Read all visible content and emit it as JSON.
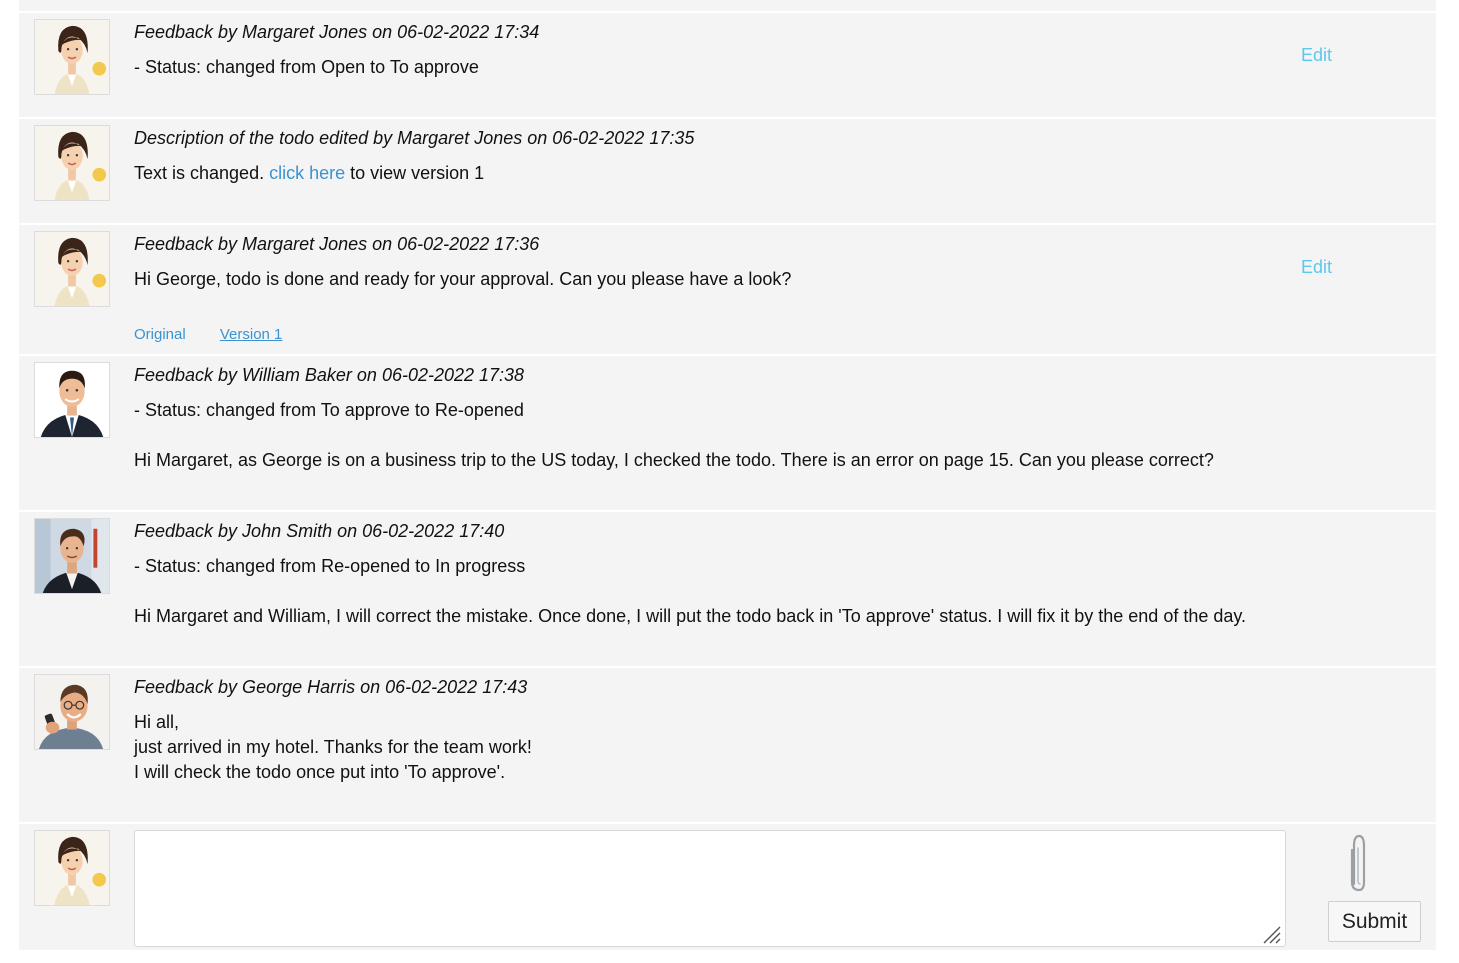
{
  "entries": [
    {
      "author": "margaret",
      "header": "Feedback by Margaret Jones on 06-02-2022 17:34",
      "lines": [
        "- Status: changed from Open to To approve"
      ],
      "edit_label": "Edit"
    },
    {
      "author": "margaret",
      "header": "Description of the todo edited by Margaret Jones on 06-02-2022 17:35",
      "text_before": "Text is changed. ",
      "link_text": "click here",
      "text_after": " to view version 1"
    },
    {
      "author": "margaret",
      "header": "Feedback by Margaret Jones on 06-02-2022 17:36",
      "lines": [
        "Hi George, todo is done and ready for your approval. Can you please have a look?"
      ],
      "edit_label": "Edit",
      "version_links": [
        "Original",
        "Version 1"
      ]
    },
    {
      "author": "william",
      "header": "Feedback by William Baker on 06-02-2022 17:38",
      "lines": [
        "- Status: changed from To approve to Re-opened",
        "Hi Margaret, as George is on a business trip to the US today, I checked the todo. There is an error on page 15. Can you please correct?"
      ]
    },
    {
      "author": "john",
      "header": "Feedback by John Smith on 06-02-2022 17:40",
      "lines": [
        "- Status: changed from Re-opened to In progress",
        "Hi Margaret and William, I will correct the mistake. Once done, I will put the todo back in 'To approve' status. I will fix it by the end of the day."
      ]
    },
    {
      "author": "george",
      "header": "Feedback by George Harris on 06-02-2022 17:43",
      "lines": [
        "Hi all,",
        "just arrived in my hotel. Thanks for the team work!",
        "I will check the todo once put into 'To approve'."
      ]
    }
  ],
  "composer": {
    "author": "margaret",
    "textarea_value": "",
    "submit_label": "Submit",
    "attach_icon": "paperclip-icon"
  },
  "colors": {
    "row_background": "#f4f4f4",
    "link": "#3a93d0",
    "edit_link": "#5cc8ec"
  }
}
